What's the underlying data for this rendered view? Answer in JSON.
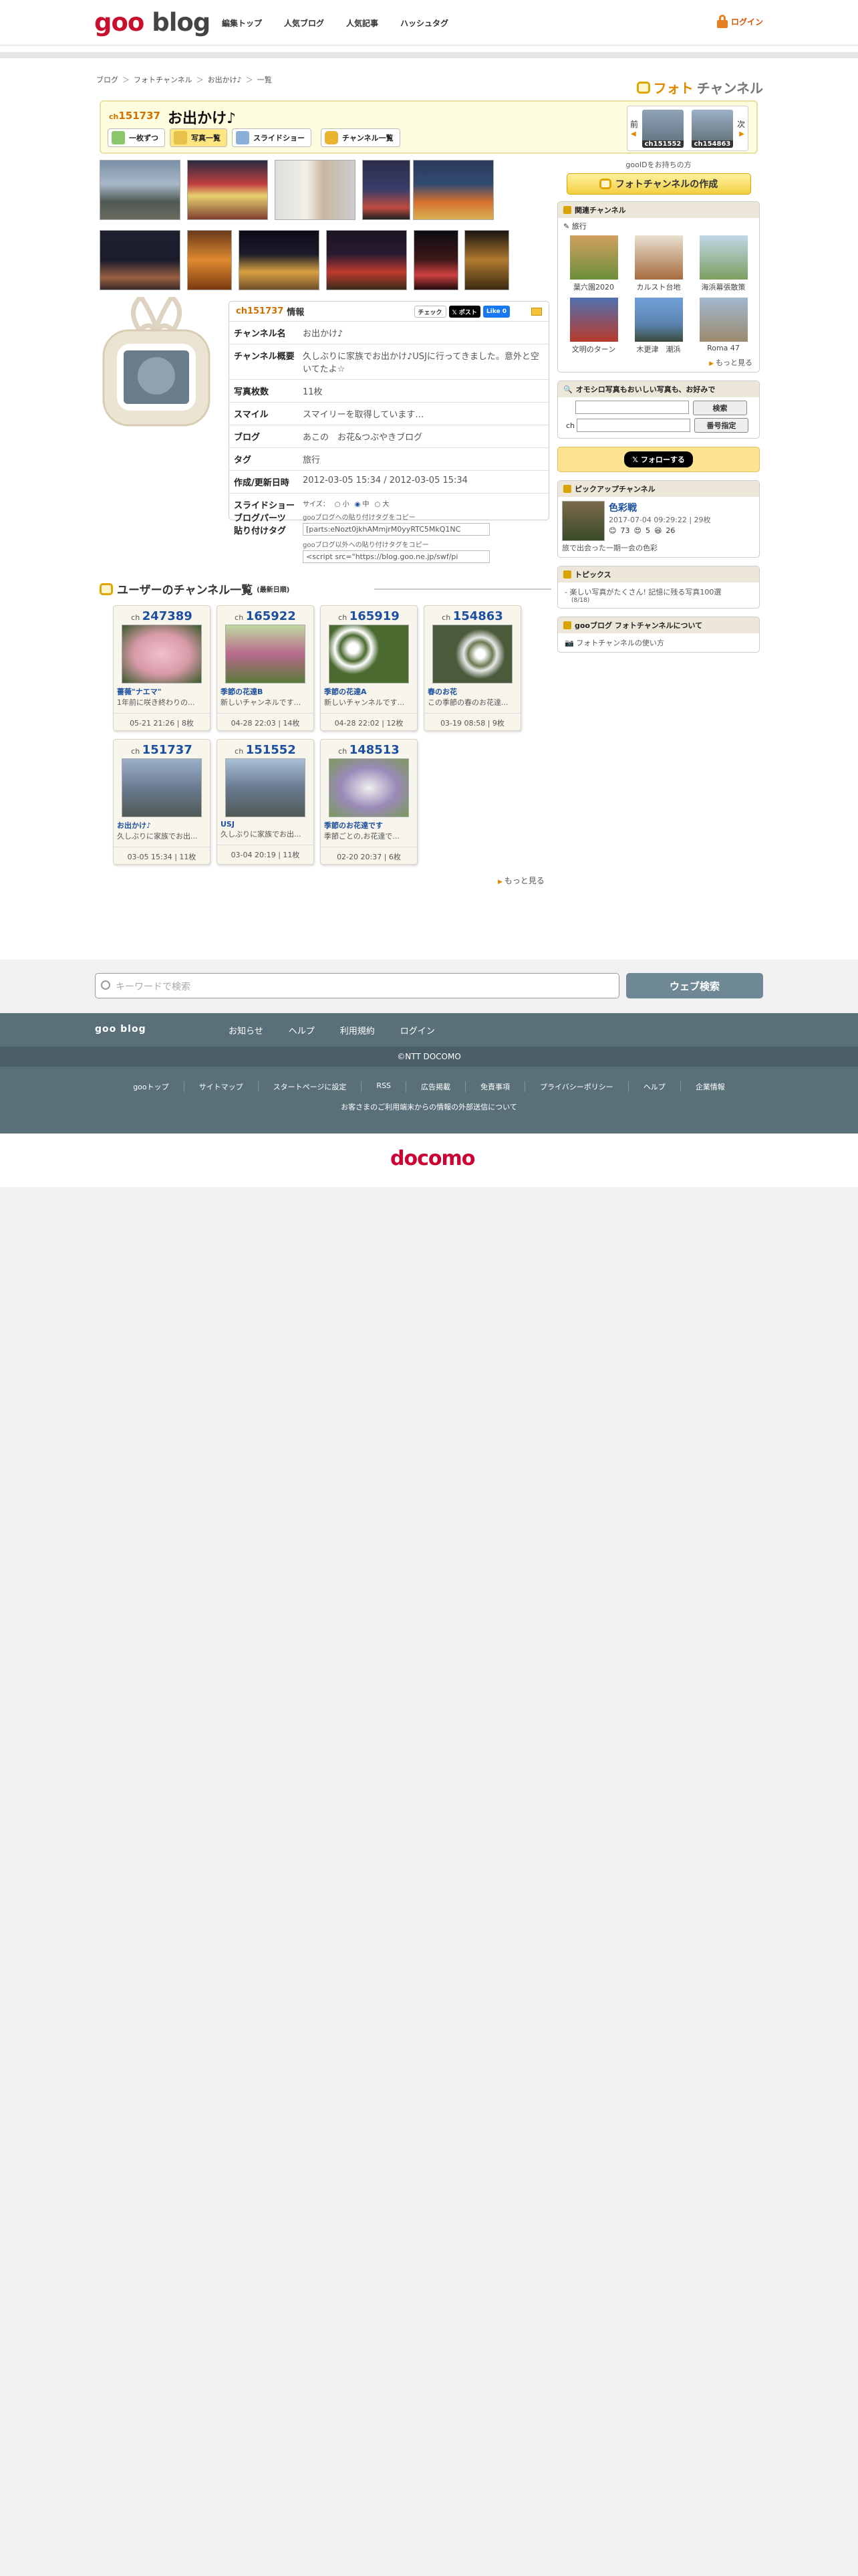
{
  "header": {
    "logo_goo": "goo",
    "logo_blog": "blog",
    "nav": [
      "編集トップ",
      "人気ブログ",
      "人気記事",
      "ハッシュタグ"
    ],
    "login": "ログイン"
  },
  "breadcrumb": [
    "ブログ",
    "フォトチャンネル",
    "お出かけ♪",
    "一覧"
  ],
  "brand": {
    "photo": "フォト",
    "channel": "チャンネル"
  },
  "channel": {
    "id_prefix": "ch",
    "id": "151737",
    "title": "お出かけ♪",
    "tabs": [
      "一枚ずつ",
      "写真一覧",
      "スライドショー",
      "チャンネル一覧"
    ],
    "active_tab": 1,
    "prev_label": "前",
    "next_label": "次",
    "prev_id": "ch151552",
    "next_id": "ch154863"
  },
  "info": {
    "head_id": "ch151737",
    "head_label": "情報",
    "social": [
      "チェック",
      "𝕏 ポスト",
      "Like 0"
    ],
    "rows": [
      {
        "k": "チャンネル名",
        "v": "お出かけ♪"
      },
      {
        "k": "チャンネル概要",
        "v": "久しぶりに家族でお出かけ♪USJに行ってきました。意外と空いてたよ☆"
      },
      {
        "k": "写真枚数",
        "v": "11枚"
      },
      {
        "k": "スマイル",
        "v": "スマイリーを取得しています…"
      },
      {
        "k": "ブログ",
        "v": "あこの　お花&つぶやきブログ"
      },
      {
        "k": "タグ",
        "v": "旅行"
      },
      {
        "k": "作成/更新日時",
        "v": "2012-03-05 15:34 / 2012-03-05 15:34"
      }
    ],
    "embed_label": "スライドショー ブログパーツ 貼り付けタグ",
    "size_label": "サイズ：",
    "sizes": [
      "小",
      "中",
      "大"
    ],
    "selected_size": "中",
    "copy1": "gooブログへの貼り付けタグをコピー",
    "tag1": "[parts:eNozt0jkhAMmjrM0yyRTC5MkQ1NC",
    "copy2": "gooブログ以外への貼り付けタグをコピー",
    "tag2": "<script src=\"https://blog.goo.ne.jp/swf/pi"
  },
  "sidebar": {
    "goo_id_label": "gooIDをお持ちの方",
    "create_btn": "フォトチャンネルの作成",
    "related_title": "関連チャンネル",
    "related_tag": "旅行",
    "related": [
      {
        "name": "葉六園2020",
        "color": "#6b8f3a"
      },
      {
        "name": "カルスト台地",
        "color": "#a76c3f"
      },
      {
        "name": "海浜幕張散策",
        "color": "#7d9f60"
      },
      {
        "name": "文明のターン",
        "color": "#b83a2a"
      },
      {
        "name": "木更津　潮浜",
        "color": "#5c84b0"
      },
      {
        "name": "Roma 47",
        "color": "#9c8a6d"
      }
    ],
    "more": "もっと見る",
    "search_title": "オモシロ写真もおいしい写真も、お好みで",
    "search_btn": "検索",
    "ch_label": "ch",
    "number_btn": "番号指定",
    "follow": "𝕏 フォローする",
    "pickup_title": "ピックアップチャンネル",
    "pickup_name": "色彩戦",
    "pickup_date": "2017-07-04 09:29:22 | 29枚",
    "pickup_smiles": [
      "73",
      "5",
      "26"
    ],
    "pickup_desc": "旅で出会った一期一会の色彩",
    "topics_title": "トピックス",
    "topics_item": "楽しい写真がたくさん! 記憶に残る写真100選",
    "topics_date": "(8/18)",
    "about_title": "gooブログ フォトチャンネルについて",
    "about_item": "フォトチャンネルの使い方"
  },
  "users": {
    "title": "ユーザーのチャンネル一覧",
    "sub": "(最新日順)",
    "cards": [
      {
        "id": "247389",
        "title": "薔薇\"ナエマ\"",
        "desc": "1年前に咲き終わりの...",
        "date": "05-21 21:26 | 8枚",
        "color": "#d89aa8"
      },
      {
        "id": "165922",
        "title": "季節の花達B",
        "desc": "新しいチャンネルです...",
        "date": "04-28 22:03 | 14枚",
        "color": "#b86a8c"
      },
      {
        "id": "165919",
        "title": "季節の花達A",
        "desc": "新しいチャンネルです...",
        "date": "04-28 22:02 | 12枚",
        "color": "#4a6a30"
      },
      {
        "id": "154863",
        "title": "春のお花",
        "desc": "この季節の春のお花達...",
        "date": "03-19 08:58 | 9枚",
        "color": "#6a7a50"
      },
      {
        "id": "151737",
        "title": "お出かけ♪",
        "desc": "久しぶりに家族でお出...",
        "date": "03-05 15:34 | 11枚",
        "color": "#6a7a90"
      },
      {
        "id": "151552",
        "title": "USJ",
        "desc": "久しぶりに家族でお出...",
        "date": "03-04 20:19 | 11枚",
        "color": "#6a7a90"
      },
      {
        "id": "148513",
        "title": "季節のお花達です",
        "desc": "季節ごとの,お花達で...",
        "date": "02-20 20:37 | 6枚",
        "color": "#9a8ab8"
      }
    ],
    "more": "もっと見る"
  },
  "search": {
    "placeholder": "キーワードで検索",
    "button": "ウェブ検索"
  },
  "footer": {
    "brand": "goo blog",
    "nav": [
      "お知らせ",
      "ヘルプ",
      "利用規約",
      "ログイン"
    ],
    "copyright": "©NTT DOCOMO",
    "links": [
      "gooトップ",
      "サイトマップ",
      "スタートページに設定",
      "RSS",
      "広告掲載",
      "免責事項",
      "プライバシーポリシー",
      "ヘルプ",
      "企業情報"
    ],
    "notice": "お客さまのご利用端末からの情報の外部送信について",
    "docomo": "docomo"
  },
  "colors": {
    "accent": "#d07000",
    "brand_red": "#c8102e",
    "link_blue": "#1d4fa0",
    "footer": "#597079"
  }
}
